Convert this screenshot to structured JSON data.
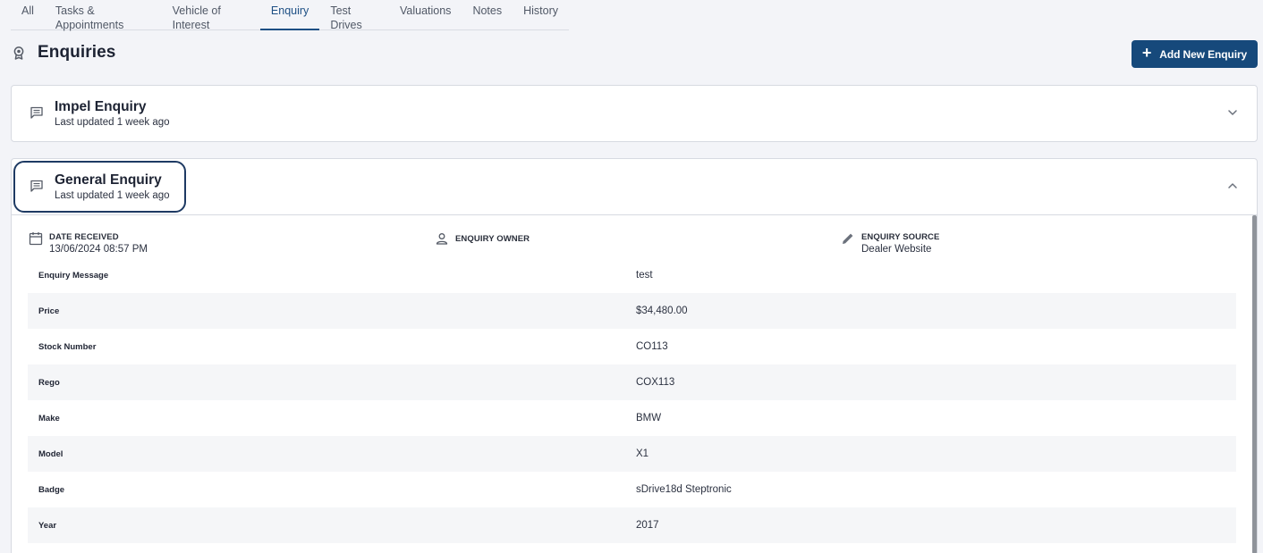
{
  "tabs": [
    "All",
    "Tasks & Appointments",
    "Vehicle of Interest",
    "Enquiry",
    "Test Drives",
    "Valuations",
    "Notes",
    "History"
  ],
  "active_tab": "Enquiry",
  "page": {
    "title": "Enquiries",
    "title_icon": "award-icon",
    "add_button_label": "Add New Enquiry"
  },
  "enquiries": [
    {
      "title": "Impel Enquiry",
      "subtitle": "Last updated 1 week ago",
      "expanded": false
    },
    {
      "title": "General Enquiry",
      "subtitle": "Last updated 1 week ago",
      "expanded": true,
      "meta": {
        "date_label": "DATE RECEIVED",
        "date_value": "13/06/2024 08:57 PM",
        "owner_label": "ENQUIRY OWNER",
        "source_label": "ENQUIRY SOURCE",
        "source_value": "Dealer Website"
      },
      "details": [
        {
          "key": "Enquiry Message",
          "value": "test"
        },
        {
          "key": "Price",
          "value": "$34,480.00"
        },
        {
          "key": "Stock Number",
          "value": "CO113"
        },
        {
          "key": "Rego",
          "value": "COX113"
        },
        {
          "key": "Make",
          "value": "BMW"
        },
        {
          "key": "Model",
          "value": "X1"
        },
        {
          "key": "Badge",
          "value": "sDrive18d Steptronic"
        },
        {
          "key": "Year",
          "value": "2017"
        }
      ]
    }
  ],
  "colors": {
    "accent": "#16497b",
    "active_tab": "#1d4f84",
    "focus_ring": "#1e3a63",
    "background": "#f3f4f8"
  }
}
